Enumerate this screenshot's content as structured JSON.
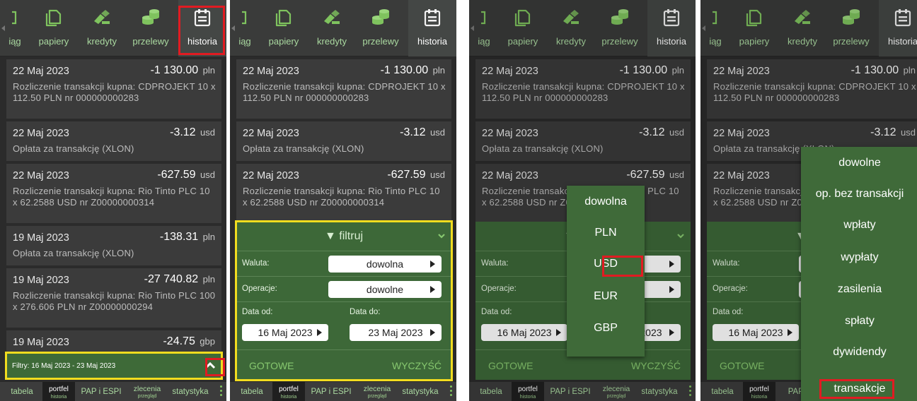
{
  "nav": {
    "tabs": [
      "iąg",
      "papiery",
      "kredyty",
      "przelewy",
      "historia"
    ],
    "icons": [
      "bracket-icon",
      "papers-icon",
      "credit-icon",
      "coins-icon",
      "calendar-icon"
    ]
  },
  "transactions": [
    {
      "date": "22 Maj 2023",
      "amount": "-1 130.00",
      "currency": "pln",
      "desc": "Rozliczenie transakcji kupna: CDPROJEKT 10 x 112.50 PLN nr 000000000283"
    },
    {
      "date": "22 Maj 2023",
      "amount": "-3.12",
      "currency": "usd",
      "desc": "Opłata za transakcję (XLON)"
    },
    {
      "date": "22 Maj 2023",
      "amount": "-627.59",
      "currency": "usd",
      "desc": "Rozliczenie transakcji kupna: Rio Tinto PLC 10 x 62.2588 USD nr Z00000000314"
    },
    {
      "date": "19 Maj 2023",
      "amount": "-138.31",
      "currency": "pln",
      "desc": "Opłata za transakcję (XLON)"
    },
    {
      "date": "19 Maj 2023",
      "amount": "-27 740.82",
      "currency": "pln",
      "desc": "Rozliczenie transakcji kupna: Rio Tinto PLC 100 x 276.606 PLN nr Z00000000294"
    },
    {
      "date": "19 Maj 2023",
      "amount": "-24.75",
      "currency": "gbp",
      "desc": ""
    }
  ],
  "filter_bar": {
    "text": "Filtry: 16 Maj 2023 - 23 Maj 2023"
  },
  "filter_panel": {
    "title": "filtruj",
    "waluta_label": "Waluta:",
    "waluta_value": "dowolna",
    "operacje_label": "Operacje:",
    "operacje_value": "dowolne",
    "date_from_label": "Data od:",
    "date_to_label": "Data do:",
    "date_from": "16 Maj 2023",
    "date_to": "23 Maj 2023",
    "done": "GOTOWE",
    "clear": "WYCZYŚĆ"
  },
  "currency_options": [
    "dowolna",
    "PLN",
    "USD",
    "EUR",
    "GBP"
  ],
  "operation_options": [
    "dowolne",
    "op. bez transakcji",
    "wpłaty",
    "wypłaty",
    "zasilenia",
    "spłaty",
    "dywidendy",
    "transakcje"
  ],
  "bottom_nav": {
    "tabela": "tabela",
    "portfel": "portfel",
    "portfel_sub": "historia",
    "pap": "PAP i ESPI",
    "pap_cut": "PAP i E",
    "zlecenia": "zlecenia",
    "zlecenia_sub": "przegląd",
    "statystyka": "statystyka"
  },
  "colors": {
    "panel": "#2b2b2b",
    "card": "#3b3b3b",
    "green": "#3e6a38",
    "accent": "#7fc35e",
    "highlight_red": "#e11b22",
    "highlight_yellow": "#f2dc1f"
  }
}
